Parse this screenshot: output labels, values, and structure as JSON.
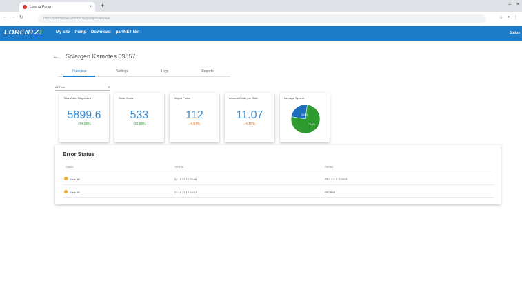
{
  "browser": {
    "tab_title": "Lorentz Pump",
    "url": "https://partnernet.lorentz.de/pump/overview",
    "new_tab_icon": "+",
    "nav_icons": [
      "back-arrow",
      "forward-arrow",
      "reload"
    ]
  },
  "appbar": {
    "logo_main": "LORENTZ",
    "logo_accent": "Σ",
    "menu": [
      "My site",
      "Pump",
      "Download",
      "partNET Net"
    ],
    "user": "Status"
  },
  "page": {
    "back_icon": "←",
    "title": "Solargen Kamotes 09857",
    "tabs": [
      "Overview",
      "Settings",
      "Logs",
      "Reports"
    ],
    "active_tab": 0,
    "range_value": "All Time"
  },
  "kpis": [
    {
      "label": "Total Water Dispensed",
      "value": "5899.6",
      "delta": "↑74.05%",
      "trend": "up"
    },
    {
      "label": "Solar Hours",
      "value": "533",
      "delta": "↑20.85%",
      "trend": "up"
    },
    {
      "label": "Output Power",
      "value": "112",
      "delta": "↓4.07%",
      "trend": "down"
    },
    {
      "label": "Amount Water per Sold",
      "value": "11.07",
      "delta": "↓4.15%",
      "trend": "down"
    },
    {
      "label": "Average System",
      "pie": [
        {
          "label": "24.4%",
          "value": 24.4,
          "color": "#1d6fbd"
        },
        {
          "label": "75.6%",
          "value": 75.6,
          "color": "#2e9a2f"
        }
      ]
    }
  ],
  "errors": {
    "title": "Error Status",
    "columns": [
      "Status",
      "Time in",
      "Device"
    ],
    "rows": [
      {
        "status": "Error 88",
        "time": "24.10.21 12:26:08",
        "device": "PS2-1.8 C-SJ42-8"
      },
      {
        "status": "Error 88",
        "time": "23.10.21 12:18:07",
        "device": "PS2R4S"
      }
    ]
  },
  "colors": {
    "brand": "#1d7bc8",
    "accent": "#8fd14f",
    "kpi_value": "#3b8fd4",
    "up": "#3aa13c",
    "down": "#e06a1b",
    "warning": "#f5a623"
  }
}
